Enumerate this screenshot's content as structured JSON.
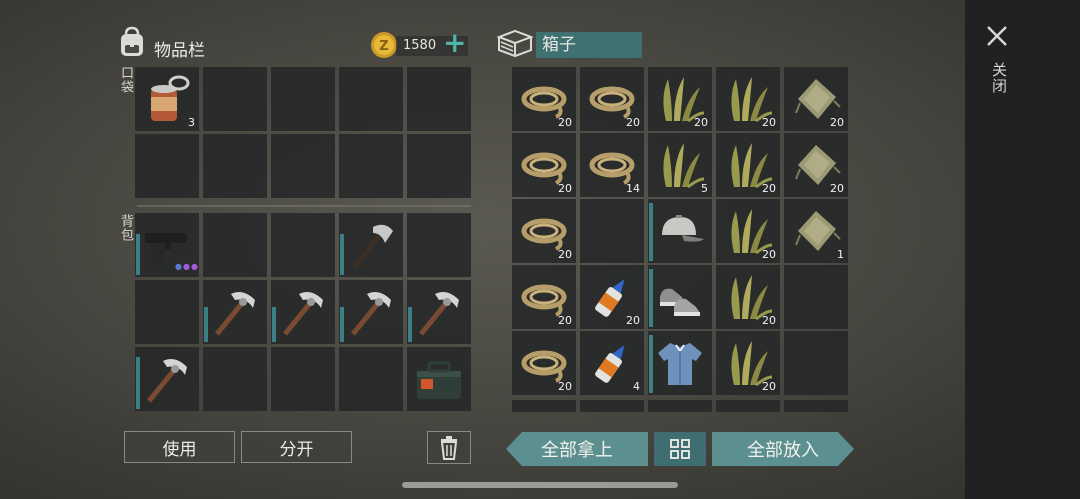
{
  "inventory": {
    "title": "物品栏",
    "coins": "1580",
    "plus_symbol": "+",
    "pocket_label": "口袋",
    "backpack_label": "背包",
    "pocket_slots": [
      {
        "item": "can-icon",
        "count": "3"
      },
      {
        "item": "",
        "count": ""
      },
      {
        "item": "",
        "count": ""
      },
      {
        "item": "",
        "count": ""
      },
      {
        "item": "",
        "count": ""
      },
      {
        "item": "",
        "count": ""
      },
      {
        "item": "",
        "count": ""
      },
      {
        "item": "",
        "count": ""
      },
      {
        "item": "",
        "count": ""
      },
      {
        "item": "",
        "count": ""
      }
    ],
    "backpack_slots": [
      {
        "item": "pistol-icon",
        "count": "",
        "bar": 0.7
      },
      {
        "item": "",
        "count": ""
      },
      {
        "item": "",
        "count": ""
      },
      {
        "item": "hatchet-icon",
        "count": "",
        "bar": 0.7
      },
      {
        "item": "",
        "count": ""
      },
      {
        "item": "",
        "count": ""
      },
      {
        "item": "pickaxe-icon",
        "count": "",
        "bar": 0.6
      },
      {
        "item": "pickaxe-icon",
        "count": "",
        "bar": 0.6
      },
      {
        "item": "pickaxe-icon",
        "count": "",
        "bar": 0.6
      },
      {
        "item": "pickaxe-icon",
        "count": "",
        "bar": 0.6
      },
      {
        "item": "pickaxe-icon",
        "count": "",
        "bar": 0.9
      },
      {
        "item": "",
        "count": ""
      },
      {
        "item": "",
        "count": ""
      },
      {
        "item": "",
        "count": ""
      },
      {
        "item": "toolbox-icon",
        "count": ""
      }
    ],
    "use_button": "使用",
    "split_button": "分开"
  },
  "box": {
    "title": "箱子",
    "slots": [
      {
        "item": "rope-icon",
        "count": "20"
      },
      {
        "item": "rope-icon",
        "count": "20"
      },
      {
        "item": "plant-fiber-icon",
        "count": "20"
      },
      {
        "item": "plant-fiber-icon",
        "count": "20"
      },
      {
        "item": "cloth-icon",
        "count": "20"
      },
      {
        "item": "rope-icon",
        "count": "20"
      },
      {
        "item": "rope-icon",
        "count": "14"
      },
      {
        "item": "plant-fiber-icon",
        "count": "5"
      },
      {
        "item": "plant-fiber-icon",
        "count": "20"
      },
      {
        "item": "cloth-icon",
        "count": "20"
      },
      {
        "item": "rope-icon",
        "count": "20"
      },
      {
        "item": "",
        "count": ""
      },
      {
        "item": "cap-icon",
        "count": "",
        "bar": 1
      },
      {
        "item": "plant-fiber-icon",
        "count": "20"
      },
      {
        "item": "cloth-icon",
        "count": "1"
      },
      {
        "item": "rope-icon",
        "count": "20"
      },
      {
        "item": "glue-icon",
        "count": "20"
      },
      {
        "item": "sneakers-icon",
        "count": "",
        "bar": 1
      },
      {
        "item": "plant-fiber-icon",
        "count": "20"
      },
      {
        "item": "",
        "count": ""
      },
      {
        "item": "rope-icon",
        "count": "20"
      },
      {
        "item": "glue-icon",
        "count": "4"
      },
      {
        "item": "shirt-icon",
        "count": "",
        "bar": 1
      },
      {
        "item": "plant-fiber-icon",
        "count": "20"
      },
      {
        "item": "",
        "count": ""
      }
    ],
    "take_all_button": "全部拿上",
    "put_all_button": "全部放入"
  },
  "close_label": "关闭"
}
